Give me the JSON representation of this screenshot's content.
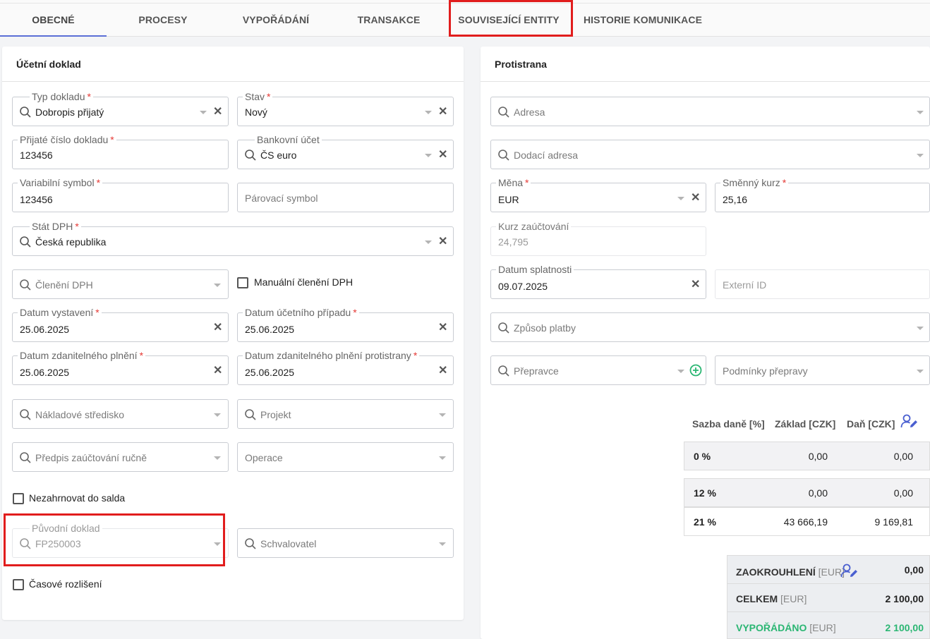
{
  "tabs": [
    {
      "label": "OBECNÉ",
      "active": true
    },
    {
      "label": "PROCESY"
    },
    {
      "label": "VYPOŘÁDÁNÍ"
    },
    {
      "label": "TRANSAKCE"
    },
    {
      "label": "SOUVISEJÍCÍ ENTITY",
      "highlighted": true
    },
    {
      "label": "HISTORIE KOMUNIKACE"
    }
  ],
  "left_card": {
    "title": "Účetní doklad",
    "typ_dokladu": {
      "label": "Typ dokladu",
      "value": "Dobropis přijatý"
    },
    "stav": {
      "label": "Stav",
      "value": "Nový"
    },
    "prijate_cislo": {
      "label": "Přijaté číslo dokladu",
      "value": "123456"
    },
    "bankovni_ucet": {
      "label": "Bankovní účet",
      "value": "ČS euro"
    },
    "variabilni_symbol": {
      "label": "Variabilní symbol",
      "value": "123456"
    },
    "parovaci_symbol": {
      "placeholder": "Párovací symbol"
    },
    "stat_dph": {
      "label": "Stát DPH",
      "value": "Česká republika"
    },
    "cleneni_dph": {
      "placeholder": "Členění DPH"
    },
    "manualni_cleneni": {
      "label": "Manuální členění DPH",
      "checked": false
    },
    "datum_vystaveni": {
      "label": "Datum vystavení",
      "value": "25.06.2025"
    },
    "datum_ucetniho": {
      "label": "Datum účetního případu",
      "value": "25.06.2025"
    },
    "datum_zdanitelneho": {
      "label": "Datum zdanitelného plnění",
      "value": "25.06.2025"
    },
    "datum_zdanitelneho_protistrany": {
      "label": "Datum zdanitelného plnění protistrany",
      "value": "25.06.2025"
    },
    "nakladove_stredisko": {
      "placeholder": "Nákladové středisko"
    },
    "projekt": {
      "placeholder": "Projekt"
    },
    "predpis_zauctovani": {
      "placeholder": "Předpis zaúčtování ručně"
    },
    "operace": {
      "placeholder": "Operace"
    },
    "nezahrnovat": {
      "label": "Nezahrnovat do salda",
      "checked": false
    },
    "puvodni_doklad": {
      "label": "Původní doklad",
      "value": "FP250003",
      "disabled": true,
      "highlighted": true
    },
    "schvalovatel": {
      "placeholder": "Schvalovatel"
    },
    "casove_rozliseni": {
      "label": "Časové rozlišení",
      "checked": false
    }
  },
  "right_card": {
    "title": "Protistrana",
    "adresa": {
      "placeholder": "Adresa"
    },
    "dodaci_adresa": {
      "placeholder": "Dodací adresa"
    },
    "mena": {
      "label": "Měna",
      "value": "EUR"
    },
    "smenny_kurz": {
      "label": "Směnný kurz",
      "value": "25,16"
    },
    "kurz_zauctovani": {
      "label": "Kurz zaúčtování",
      "value": "24,795",
      "disabled": true
    },
    "datum_splatnosti": {
      "label": "Datum splatnosti",
      "value": "09.07.2025"
    },
    "externi_id": {
      "placeholder": "Externí ID"
    },
    "zpusob_platby": {
      "placeholder": "Způsob platby"
    },
    "prepravce": {
      "placeholder": "Přepravce"
    },
    "podminky_prepravy": {
      "placeholder": "Podmínky přepravy"
    }
  },
  "tax_table": {
    "headers": [
      "Sazba daně [%]",
      "Základ [CZK]",
      "Daň [CZK]"
    ],
    "rows": [
      {
        "rate": "0 %",
        "base": "0,00",
        "tax": "0,00"
      },
      {
        "rate": "12 %",
        "base": "0,00",
        "tax": "0,00"
      },
      {
        "rate": "21 %",
        "base": "43 666,19",
        "tax": "9 169,81"
      }
    ]
  },
  "summary": {
    "rounding": {
      "label": "ZAOKROUHLENÍ",
      "unit": "[EUR]",
      "value": "0,00"
    },
    "total": {
      "label": "CELKEM",
      "unit": "[EUR]",
      "value": "2 100,00"
    },
    "settled": {
      "label": "VYPOŘÁDÁNO",
      "unit": "[EUR]",
      "value": "2 100,00"
    }
  },
  "colors": {
    "accent": "#5b6fd6",
    "highlight": "#e11d1d",
    "green": "#2bb673",
    "required": "#e53935"
  }
}
